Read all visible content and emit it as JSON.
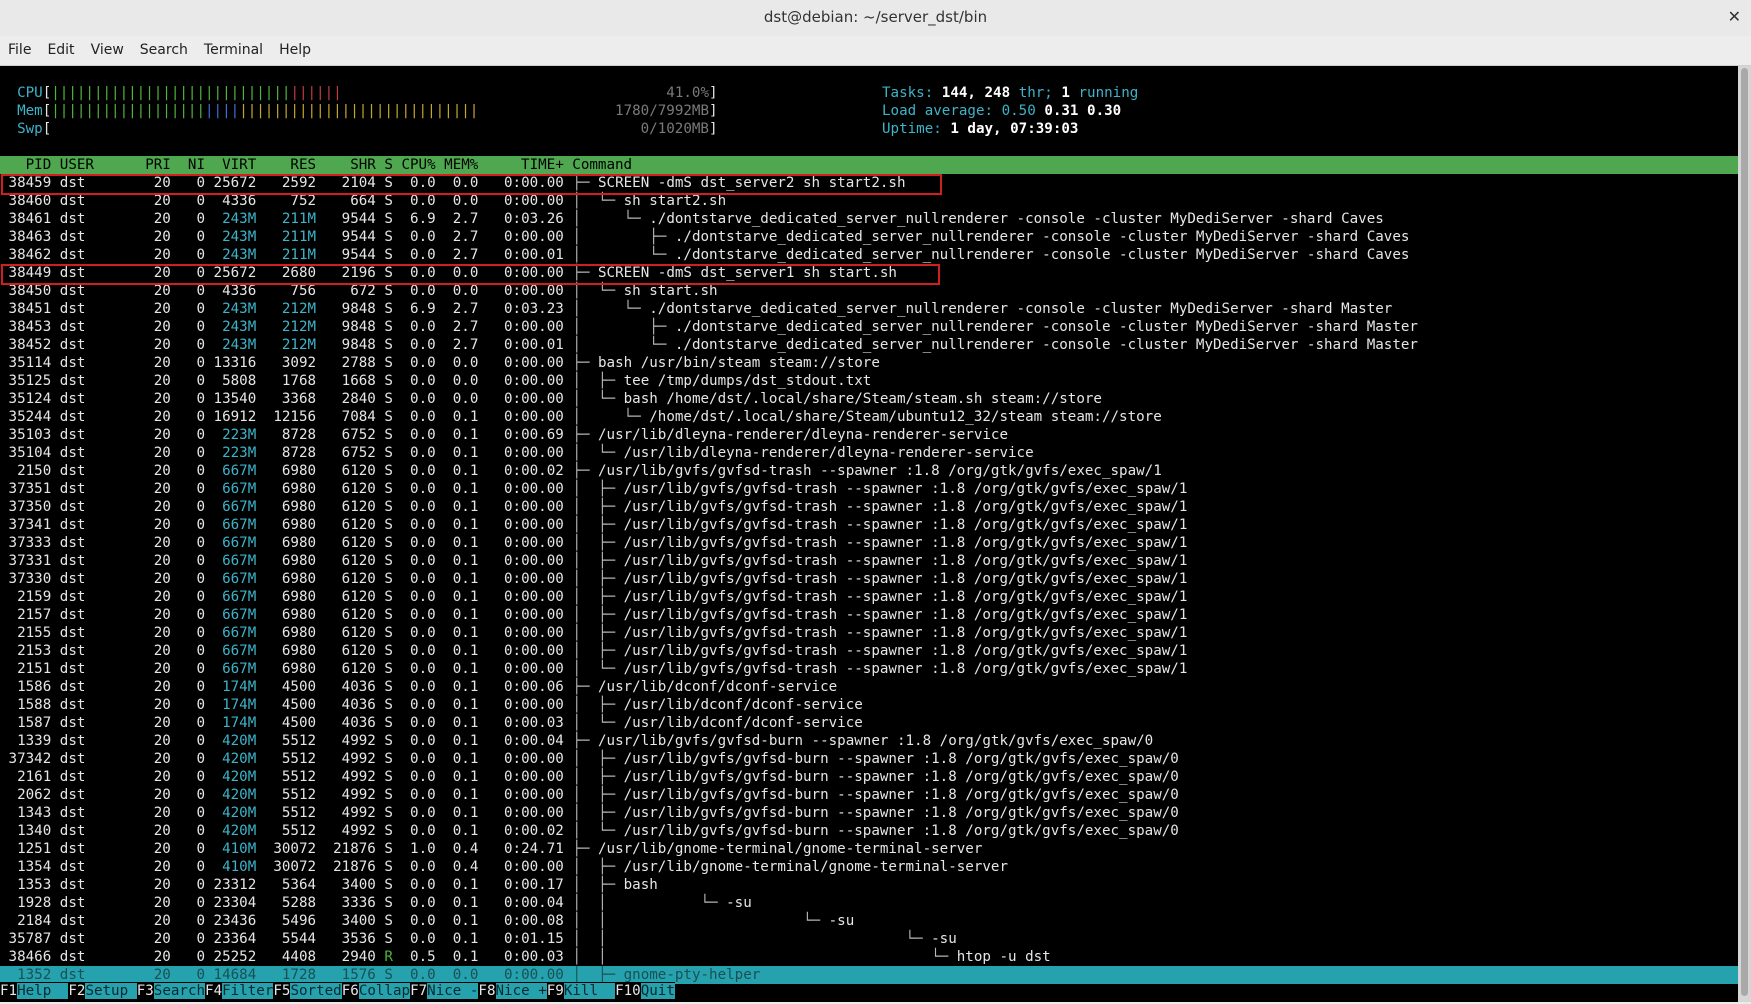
{
  "window": {
    "title": "dst@debian: ~/server_dst/bin",
    "close_glyph": "✕"
  },
  "menu": [
    "File",
    "Edit",
    "View",
    "Search",
    "Terminal",
    "Help"
  ],
  "meters": {
    "cpu": {
      "label": "CPU",
      "percent": "41.0%",
      "bar_green": 28,
      "bar_red": 6,
      "fraction": 0.41
    },
    "mem": {
      "label": "Mem",
      "value": "1780/7992MB",
      "bar_green": 18,
      "bar_blue": 4,
      "bar_yellow": 28,
      "fraction": 0.22
    },
    "swp": {
      "label": "Swp",
      "value": "0/1020MB",
      "fraction": 0.0
    }
  },
  "stats": {
    "tasks_label": "Tasks:",
    "tasks": "144,",
    "threads": "248",
    "thr_label": "thr;",
    "running": "1",
    "running_label": "running",
    "load_label": "Load average:",
    "load1": "0.50",
    "load5": "0.31",
    "load15": "0.30",
    "uptime_label": "Uptime:",
    "uptime": "1 day, 07:39:03"
  },
  "columns": [
    "PID",
    "USER",
    "PRI",
    "NI",
    "VIRT",
    "RES",
    "SHR",
    "S",
    "CPU%",
    "MEM%",
    "TIME+",
    "Command"
  ],
  "processes": [
    [
      "38459",
      "dst",
      "20",
      "0",
      "25672",
      "2592",
      "2104",
      "S",
      "0.0",
      "0.0",
      "0:00.00",
      "├─ ",
      "SCREEN -dmS dst_server2 sh start2.sh"
    ],
    [
      "38460",
      "dst",
      "20",
      "0",
      "4336",
      "752",
      "664",
      "S",
      "0.0",
      "0.0",
      "0:00.00",
      "│  └─ ",
      "sh start2.sh"
    ],
    [
      "38461",
      "dst",
      "20",
      "0",
      "243M",
      "211M",
      "9544",
      "S",
      "6.9",
      "2.7",
      "0:03.26",
      "│     └─ ",
      "./dontstarve_dedicated_server_nullrenderer -console -cluster MyDediServer -shard Caves"
    ],
    [
      "38463",
      "dst",
      "20",
      "0",
      "243M",
      "211M",
      "9544",
      "S",
      "0.0",
      "2.7",
      "0:00.00",
      "│        ├─ ",
      "./dontstarve_dedicated_server_nullrenderer -console -cluster MyDediServer -shard Caves"
    ],
    [
      "38462",
      "dst",
      "20",
      "0",
      "243M",
      "211M",
      "9544",
      "S",
      "0.0",
      "2.7",
      "0:00.01",
      "│        └─ ",
      "./dontstarve_dedicated_server_nullrenderer -console -cluster MyDediServer -shard Caves"
    ],
    [
      "38449",
      "dst",
      "20",
      "0",
      "25672",
      "2680",
      "2196",
      "S",
      "0.0",
      "0.0",
      "0:00.00",
      "├─ ",
      "SCREEN -dmS dst_server1 sh start.sh"
    ],
    [
      "38450",
      "dst",
      "20",
      "0",
      "4336",
      "756",
      "672",
      "S",
      "0.0",
      "0.0",
      "0:00.00",
      "│  └─ ",
      "sh start.sh"
    ],
    [
      "38451",
      "dst",
      "20",
      "0",
      "243M",
      "212M",
      "9848",
      "S",
      "6.9",
      "2.7",
      "0:03.23",
      "│     └─ ",
      "./dontstarve_dedicated_server_nullrenderer -console -cluster MyDediServer -shard Master"
    ],
    [
      "38453",
      "dst",
      "20",
      "0",
      "243M",
      "212M",
      "9848",
      "S",
      "0.0",
      "2.7",
      "0:00.00",
      "│        ├─ ",
      "./dontstarve_dedicated_server_nullrenderer -console -cluster MyDediServer -shard Master"
    ],
    [
      "38452",
      "dst",
      "20",
      "0",
      "243M",
      "212M",
      "9848",
      "S",
      "0.0",
      "2.7",
      "0:00.01",
      "│        └─ ",
      "./dontstarve_dedicated_server_nullrenderer -console -cluster MyDediServer -shard Master"
    ],
    [
      "35114",
      "dst",
      "20",
      "0",
      "13316",
      "3092",
      "2788",
      "S",
      "0.0",
      "0.0",
      "0:00.00",
      "├─ ",
      "bash /usr/bin/steam steam://store"
    ],
    [
      "35125",
      "dst",
      "20",
      "0",
      "5808",
      "1768",
      "1668",
      "S",
      "0.0",
      "0.0",
      "0:00.00",
      "│  ├─ ",
      "tee /tmp/dumps/dst_stdout.txt"
    ],
    [
      "35124",
      "dst",
      "20",
      "0",
      "13540",
      "3368",
      "2840",
      "S",
      "0.0",
      "0.0",
      "0:00.00",
      "│  └─ ",
      "bash /home/dst/.local/share/Steam/steam.sh steam://store"
    ],
    [
      "35244",
      "dst",
      "20",
      "0",
      "16912",
      "12156",
      "7084",
      "S",
      "0.0",
      "0.1",
      "0:00.00",
      "│     └─ ",
      "/home/dst/.local/share/Steam/ubuntu12_32/steam steam://store"
    ],
    [
      "35103",
      "dst",
      "20",
      "0",
      "223M",
      "8728",
      "6752",
      "S",
      "0.0",
      "0.1",
      "0:00.69",
      "├─ ",
      "/usr/lib/dleyna-renderer/dleyna-renderer-service"
    ],
    [
      "35104",
      "dst",
      "20",
      "0",
      "223M",
      "8728",
      "6752",
      "S",
      "0.0",
      "0.1",
      "0:00.00",
      "│  └─ ",
      "/usr/lib/dleyna-renderer/dleyna-renderer-service"
    ],
    [
      "2150",
      "dst",
      "20",
      "0",
      "667M",
      "6980",
      "6120",
      "S",
      "0.0",
      "0.1",
      "0:00.02",
      "├─ ",
      "/usr/lib/gvfs/gvfsd-trash --spawner :1.8 /org/gtk/gvfs/exec_spaw/1"
    ],
    [
      "37351",
      "dst",
      "20",
      "0",
      "667M",
      "6980",
      "6120",
      "S",
      "0.0",
      "0.1",
      "0:00.00",
      "│  ├─ ",
      "/usr/lib/gvfs/gvfsd-trash --spawner :1.8 /org/gtk/gvfs/exec_spaw/1"
    ],
    [
      "37350",
      "dst",
      "20",
      "0",
      "667M",
      "6980",
      "6120",
      "S",
      "0.0",
      "0.1",
      "0:00.00",
      "│  ├─ ",
      "/usr/lib/gvfs/gvfsd-trash --spawner :1.8 /org/gtk/gvfs/exec_spaw/1"
    ],
    [
      "37341",
      "dst",
      "20",
      "0",
      "667M",
      "6980",
      "6120",
      "S",
      "0.0",
      "0.1",
      "0:00.00",
      "│  ├─ ",
      "/usr/lib/gvfs/gvfsd-trash --spawner :1.8 /org/gtk/gvfs/exec_spaw/1"
    ],
    [
      "37333",
      "dst",
      "20",
      "0",
      "667M",
      "6980",
      "6120",
      "S",
      "0.0",
      "0.1",
      "0:00.00",
      "│  ├─ ",
      "/usr/lib/gvfs/gvfsd-trash --spawner :1.8 /org/gtk/gvfs/exec_spaw/1"
    ],
    [
      "37331",
      "dst",
      "20",
      "0",
      "667M",
      "6980",
      "6120",
      "S",
      "0.0",
      "0.1",
      "0:00.00",
      "│  ├─ ",
      "/usr/lib/gvfs/gvfsd-trash --spawner :1.8 /org/gtk/gvfs/exec_spaw/1"
    ],
    [
      "37330",
      "dst",
      "20",
      "0",
      "667M",
      "6980",
      "6120",
      "S",
      "0.0",
      "0.1",
      "0:00.00",
      "│  ├─ ",
      "/usr/lib/gvfs/gvfsd-trash --spawner :1.8 /org/gtk/gvfs/exec_spaw/1"
    ],
    [
      "2159",
      "dst",
      "20",
      "0",
      "667M",
      "6980",
      "6120",
      "S",
      "0.0",
      "0.1",
      "0:00.00",
      "│  ├─ ",
      "/usr/lib/gvfs/gvfsd-trash --spawner :1.8 /org/gtk/gvfs/exec_spaw/1"
    ],
    [
      "2157",
      "dst",
      "20",
      "0",
      "667M",
      "6980",
      "6120",
      "S",
      "0.0",
      "0.1",
      "0:00.00",
      "│  ├─ ",
      "/usr/lib/gvfs/gvfsd-trash --spawner :1.8 /org/gtk/gvfs/exec_spaw/1"
    ],
    [
      "2155",
      "dst",
      "20",
      "0",
      "667M",
      "6980",
      "6120",
      "S",
      "0.0",
      "0.1",
      "0:00.00",
      "│  ├─ ",
      "/usr/lib/gvfs/gvfsd-trash --spawner :1.8 /org/gtk/gvfs/exec_spaw/1"
    ],
    [
      "2153",
      "dst",
      "20",
      "0",
      "667M",
      "6980",
      "6120",
      "S",
      "0.0",
      "0.1",
      "0:00.00",
      "│  ├─ ",
      "/usr/lib/gvfs/gvfsd-trash --spawner :1.8 /org/gtk/gvfs/exec_spaw/1"
    ],
    [
      "2151",
      "dst",
      "20",
      "0",
      "667M",
      "6980",
      "6120",
      "S",
      "0.0",
      "0.1",
      "0:00.00",
      "│  └─ ",
      "/usr/lib/gvfs/gvfsd-trash --spawner :1.8 /org/gtk/gvfs/exec_spaw/1"
    ],
    [
      "1586",
      "dst",
      "20",
      "0",
      "174M",
      "4500",
      "4036",
      "S",
      "0.0",
      "0.1",
      "0:00.06",
      "├─ ",
      "/usr/lib/dconf/dconf-service"
    ],
    [
      "1588",
      "dst",
      "20",
      "0",
      "174M",
      "4500",
      "4036",
      "S",
      "0.0",
      "0.1",
      "0:00.00",
      "│  ├─ ",
      "/usr/lib/dconf/dconf-service"
    ],
    [
      "1587",
      "dst",
      "20",
      "0",
      "174M",
      "4500",
      "4036",
      "S",
      "0.0",
      "0.1",
      "0:00.03",
      "│  └─ ",
      "/usr/lib/dconf/dconf-service"
    ],
    [
      "1339",
      "dst",
      "20",
      "0",
      "420M",
      "5512",
      "4992",
      "S",
      "0.0",
      "0.1",
      "0:00.04",
      "├─ ",
      "/usr/lib/gvfs/gvfsd-burn --spawner :1.8 /org/gtk/gvfs/exec_spaw/0"
    ],
    [
      "37342",
      "dst",
      "20",
      "0",
      "420M",
      "5512",
      "4992",
      "S",
      "0.0",
      "0.1",
      "0:00.00",
      "│  ├─ ",
      "/usr/lib/gvfs/gvfsd-burn --spawner :1.8 /org/gtk/gvfs/exec_spaw/0"
    ],
    [
      "2161",
      "dst",
      "20",
      "0",
      "420M",
      "5512",
      "4992",
      "S",
      "0.0",
      "0.1",
      "0:00.00",
      "│  ├─ ",
      "/usr/lib/gvfs/gvfsd-burn --spawner :1.8 /org/gtk/gvfs/exec_spaw/0"
    ],
    [
      "2062",
      "dst",
      "20",
      "0",
      "420M",
      "5512",
      "4992",
      "S",
      "0.0",
      "0.1",
      "0:00.00",
      "│  ├─ ",
      "/usr/lib/gvfs/gvfsd-burn --spawner :1.8 /org/gtk/gvfs/exec_spaw/0"
    ],
    [
      "1343",
      "dst",
      "20",
      "0",
      "420M",
      "5512",
      "4992",
      "S",
      "0.0",
      "0.1",
      "0:00.00",
      "│  ├─ ",
      "/usr/lib/gvfs/gvfsd-burn --spawner :1.8 /org/gtk/gvfs/exec_spaw/0"
    ],
    [
      "1340",
      "dst",
      "20",
      "0",
      "420M",
      "5512",
      "4992",
      "S",
      "0.0",
      "0.1",
      "0:00.02",
      "│  └─ ",
      "/usr/lib/gvfs/gvfsd-burn --spawner :1.8 /org/gtk/gvfs/exec_spaw/0"
    ],
    [
      "1251",
      "dst",
      "20",
      "0",
      "410M",
      "30072",
      "21876",
      "S",
      "1.0",
      "0.4",
      "0:24.71",
      "├─ ",
      "/usr/lib/gnome-terminal/gnome-terminal-server"
    ],
    [
      "1354",
      "dst",
      "20",
      "0",
      "410M",
      "30072",
      "21876",
      "S",
      "0.0",
      "0.4",
      "0:00.00",
      "│  ├─ ",
      "/usr/lib/gnome-terminal/gnome-terminal-server"
    ],
    [
      "1353",
      "dst",
      "20",
      "0",
      "23312",
      "5364",
      "3400",
      "S",
      "0.0",
      "0.1",
      "0:00.17",
      "│  ├─ ",
      "bash"
    ],
    [
      "1928",
      "dst",
      "20",
      "0",
      "23304",
      "5288",
      "3336",
      "S",
      "0.0",
      "0.1",
      "0:00.04",
      "│  │           └─ ",
      "-su"
    ],
    [
      "2184",
      "dst",
      "20",
      "0",
      "23436",
      "5496",
      "3400",
      "S",
      "0.0",
      "0.1",
      "0:00.08",
      "│  │                       └─ ",
      "-su"
    ],
    [
      "35787",
      "dst",
      "20",
      "0",
      "23364",
      "5544",
      "3536",
      "S",
      "0.0",
      "0.1",
      "0:01.15",
      "│  │                                   └─ ",
      "-su"
    ],
    [
      "38466",
      "dst",
      "20",
      "0",
      "25252",
      "4408",
      "2940",
      "R",
      "0.5",
      "0.1",
      "0:00.03",
      "│  │                                      └─ ",
      "htop -u dst"
    ],
    [
      "1352",
      "dst",
      "20",
      "0",
      "14684",
      "1728",
      "1576",
      "S",
      "0.0",
      "0.0",
      "0:00.00",
      "│  ├─ ",
      "gnome-pty-helper"
    ]
  ],
  "footer": [
    {
      "key": "F1",
      "label": "Help  "
    },
    {
      "key": "F2",
      "label": "Setup "
    },
    {
      "key": "F3",
      "label": "Search"
    },
    {
      "key": "F4",
      "label": "Filter"
    },
    {
      "key": "F5",
      "label": "Sorted"
    },
    {
      "key": "F6",
      "label": "Collap"
    },
    {
      "key": "F7",
      "label": "Nice -"
    },
    {
      "key": "F8",
      "label": "Nice +"
    },
    {
      "key": "F9",
      "label": "Kill  "
    },
    {
      "key": "F10",
      "label": "Quit"
    }
  ],
  "colors": {
    "header_green": "#4fa84f",
    "selection_teal": "#25a2ad",
    "cyan": "#3cb4c9",
    "highlight_red": "#d11f1f"
  }
}
